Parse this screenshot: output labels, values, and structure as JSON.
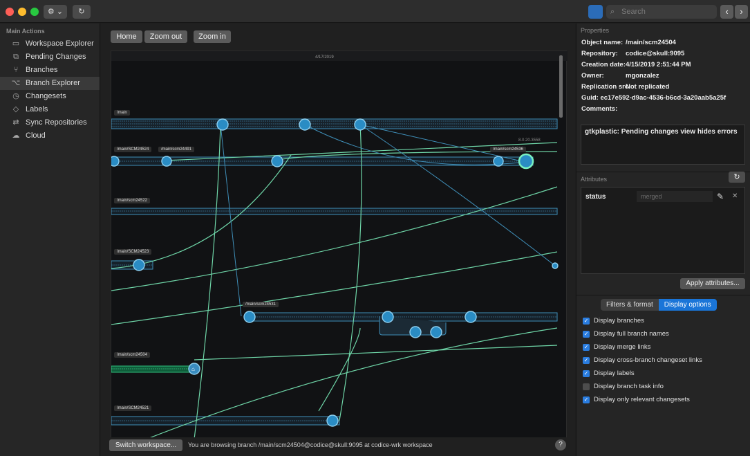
{
  "titlebar": {
    "traffic_colors": [
      "#fe5f57",
      "#febc2e",
      "#28c840"
    ],
    "gear_label": "⚙ ⌄",
    "refresh_label": "↻",
    "layout_icon": "panel-icon",
    "search_placeholder": "Search",
    "back_label": "‹",
    "forward_label": "›"
  },
  "sidebar": {
    "header": "Main Actions",
    "items": [
      {
        "label": "Workspace Explorer",
        "icon": "folder-icon",
        "glyph": "▭"
      },
      {
        "label": "Pending Changes",
        "icon": "pending-changes-icon",
        "glyph": "⧉"
      },
      {
        "label": "Branches",
        "icon": "branches-icon",
        "glyph": "⑂"
      },
      {
        "label": "Branch Explorer",
        "icon": "branch-explorer-icon",
        "glyph": "⌥",
        "active": true
      },
      {
        "label": "Changesets",
        "icon": "changesets-icon",
        "glyph": "◷"
      },
      {
        "label": "Labels",
        "icon": "label-icon",
        "glyph": "◇"
      },
      {
        "label": "Sync Repositories",
        "icon": "sync-icon",
        "glyph": "⇄"
      },
      {
        "label": "Cloud",
        "icon": "cloud-icon",
        "glyph": "☁"
      }
    ]
  },
  "toolbar": {
    "home": "Home",
    "zoom_out": "Zoom out",
    "zoom_in": "Zoom in"
  },
  "canvas": {
    "date": "4/17/2019",
    "branches": [
      "/main",
      "/main/SCM24524",
      "/main/scm24491",
      "/main/scm24536",
      "/main/scm24522",
      "/main/SCM24523",
      "/main/scm24531",
      "/main/scm24504",
      "/main/SCM24521"
    ],
    "small_label": "8.0.20.3558"
  },
  "status": {
    "switch_label": "Switch workspace...",
    "text": "You are browsing branch /main/scm24504@codice@skull:9095 at codice-wrk workspace",
    "help": "?"
  },
  "properties": {
    "title": "Properties",
    "rows": [
      {
        "k": "Object name:",
        "v": "/main/scm24504"
      },
      {
        "k": "Repository:",
        "v": "codice@skull:9095"
      },
      {
        "k": "Creation date:",
        "v": "4/15/2019 2:51:44 PM"
      },
      {
        "k": "Owner:",
        "v": "mgonzalez"
      },
      {
        "k": "Replication src:",
        "v": "Not replicated"
      }
    ],
    "guid_label": "Guid:",
    "guid": "ec17e592-d9ac-4536-b6cd-3a20aab5a25f",
    "comments_label": "Comments:",
    "comments": "gtkplastic: Pending changes view hides errors"
  },
  "attributes": {
    "title": "Attributes",
    "refresh": "↻",
    "name": "status",
    "value": "merged",
    "edit_icon": "✎",
    "delete_icon": "✕",
    "apply": "Apply attributes..."
  },
  "tabs": {
    "filters": "Filters & format",
    "display": "Display options"
  },
  "options": [
    {
      "label": "Display branches",
      "checked": true
    },
    {
      "label": "Display full branch names",
      "checked": true
    },
    {
      "label": "Display merge links",
      "checked": true
    },
    {
      "label": "Display cross-branch changeset links",
      "checked": true
    },
    {
      "label": "Display labels",
      "checked": true
    },
    {
      "label": "Display branch task info",
      "checked": false
    },
    {
      "label": "Display only relevant changesets",
      "checked": true
    }
  ]
}
